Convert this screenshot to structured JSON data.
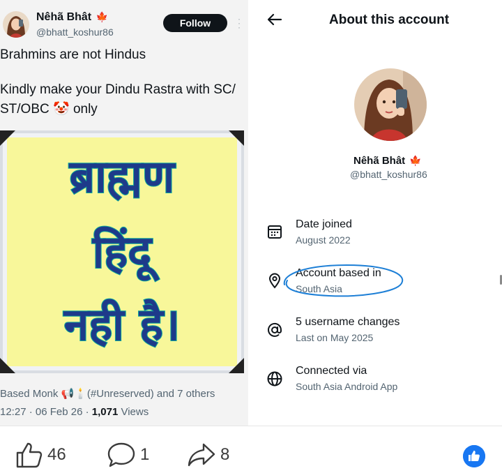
{
  "tweet": {
    "author_name": "Nêhã Bhât",
    "author_emoji": "🍁",
    "author_handle": "@bhatt_koshur86",
    "follow_label": "Follow",
    "text_lines": [
      "Brahmins are not Hindus",
      "Kindly make your Dindu Rastra with SC/",
      "ST/OBC 🤡 only"
    ],
    "image_text_lines": [
      "ब्राह्मण",
      "हिंदू",
      "नही है।"
    ],
    "liked_by": "Based Monk 📢🕯️(#Unreserved) and 7 others",
    "time_date": "12:27 · 06 Feb 26 · ",
    "views_count": "1,071",
    "views_label": " Views"
  },
  "about": {
    "title": "About this account",
    "name": "Nêhã Bhât",
    "name_emoji": "🍁",
    "handle": "@bhatt_koshur86",
    "rows": [
      {
        "icon": "calendar-icon",
        "label": "Date joined",
        "value": "August 2022"
      },
      {
        "icon": "location-pin-icon",
        "label": "Account based in",
        "value": "South Asia"
      },
      {
        "icon": "at-sign-icon",
        "label": "5 username changes",
        "value": "Last on May 2025"
      },
      {
        "icon": "globe-icon",
        "label": "Connected via",
        "value": "South Asia Android App"
      }
    ],
    "highlight_color": "#1d7fd6"
  },
  "reactions": {
    "likes": "46",
    "comments": "1",
    "shares": "8"
  },
  "colors": {
    "text": "#0f1419",
    "muted": "#536471",
    "image_bg": "#f8f79a",
    "image_text": "#1e3a8a",
    "image_outline": "#0fa89a",
    "fb_blue": "#1877f2"
  }
}
